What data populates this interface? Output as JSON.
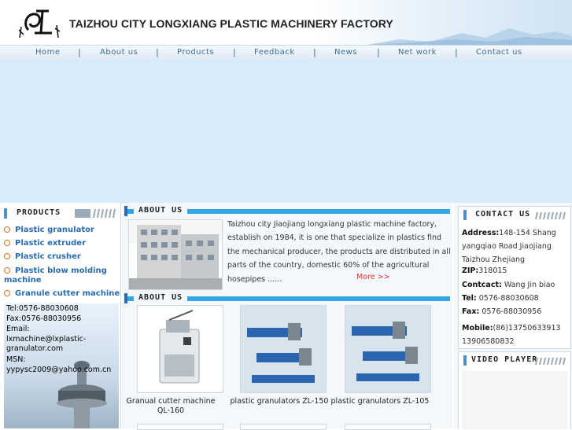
{
  "header": {
    "title": "TAIZHOU CITY LONGXIANG PLASTIC MACHINERY FACTORY"
  },
  "nav": {
    "items": [
      "Home",
      "About us",
      "Products",
      "Feedback",
      "News",
      "Net work",
      "Contact us"
    ],
    "separator": "|"
  },
  "sidebar": {
    "products_title": "PRODUCTS",
    "products": [
      "Plastic granulator",
      "Plastic extruder",
      "Plastic crusher",
      "Plastic blow molding machine",
      "Granule cutter machine"
    ],
    "contact": {
      "tel": "Tel:0576-88030608",
      "fax": "Fax:0576-88030956",
      "email_label": "Email:",
      "email": "lxmachine@lxplastic-granulator.com",
      "msn_label": "MSN:",
      "msn": "yypysc2009@yahoo.com.cn"
    }
  },
  "about": {
    "title": "ABOUT US",
    "text": "Taizhou city Jiaojiang longxiang plastic machine factory, establish on 1984, it is one that specialize in plastics find the mechanical producer, the products are distributed in all parts of the country, domestic 60% of the agricultural hosepipes ......",
    "more": "More  >>"
  },
  "products_section": {
    "title": "ABOUT US",
    "items": [
      {
        "caption": "Granual cutter machine QL-160"
      },
      {
        "caption": "plastic granulators ZL-150"
      },
      {
        "caption": "plastic granulators ZL-105"
      }
    ]
  },
  "contact_us": {
    "title": "CONTACT US",
    "address_label": "Address:",
    "address": "148-154 Shang yangqiao Road Jiaojiang Taizhou Zhejiang",
    "zip_label": "ZIP:",
    "zip": "318015",
    "contact_label": "Contcact:",
    "contact": "Wang Jin biao",
    "tel_label": "Tel:",
    "tel": "0576-88030608",
    "fax_label": "Fax:",
    "fax": "0576-88030956",
    "mobile_label": "Mobile:",
    "mobile": "(86)13750633913 13906580832"
  },
  "video": {
    "title": "VIDEO PLAYER"
  },
  "colors": {
    "link": "#2a6cb4",
    "nav": "#3c6d9b",
    "banner": "#d9ecfb",
    "stripe": "#35a5e3",
    "more": "#e03030"
  }
}
